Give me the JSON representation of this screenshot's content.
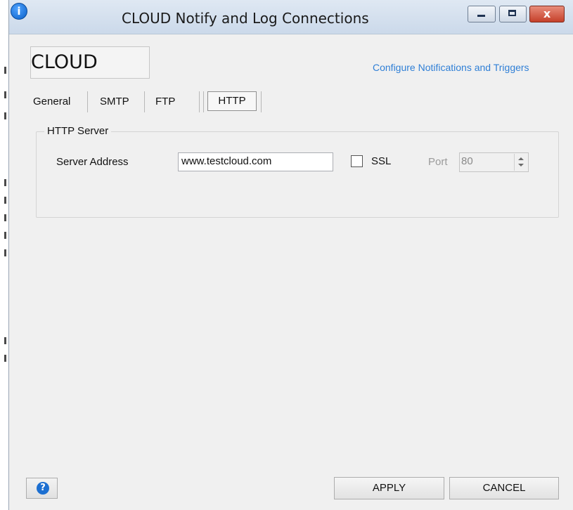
{
  "window": {
    "title": "CLOUD Notify and Log Connections",
    "close_glyph": "x"
  },
  "header": {
    "name_value": "CLOUD",
    "config_link": "Configure Notifications and Triggers"
  },
  "tabs": [
    {
      "label": "General"
    },
    {
      "label": "SMTP"
    },
    {
      "label": "FTP"
    },
    {
      "label": "HTTP",
      "active": true
    }
  ],
  "http_server": {
    "group_title": "HTTP Server",
    "server_address_label": "Server Address",
    "server_address_value": "www.testcloud.com",
    "ssl_label": "SSL",
    "ssl_checked": false,
    "port_label": "Port",
    "port_value": "80"
  },
  "footer": {
    "help_glyph": "?",
    "apply_label": "APPLY",
    "cancel_label": "CANCEL"
  },
  "colors": {
    "link": "#2f7fd6",
    "accent_blue": "#1c6fd1",
    "close_red": "#c5402a"
  }
}
